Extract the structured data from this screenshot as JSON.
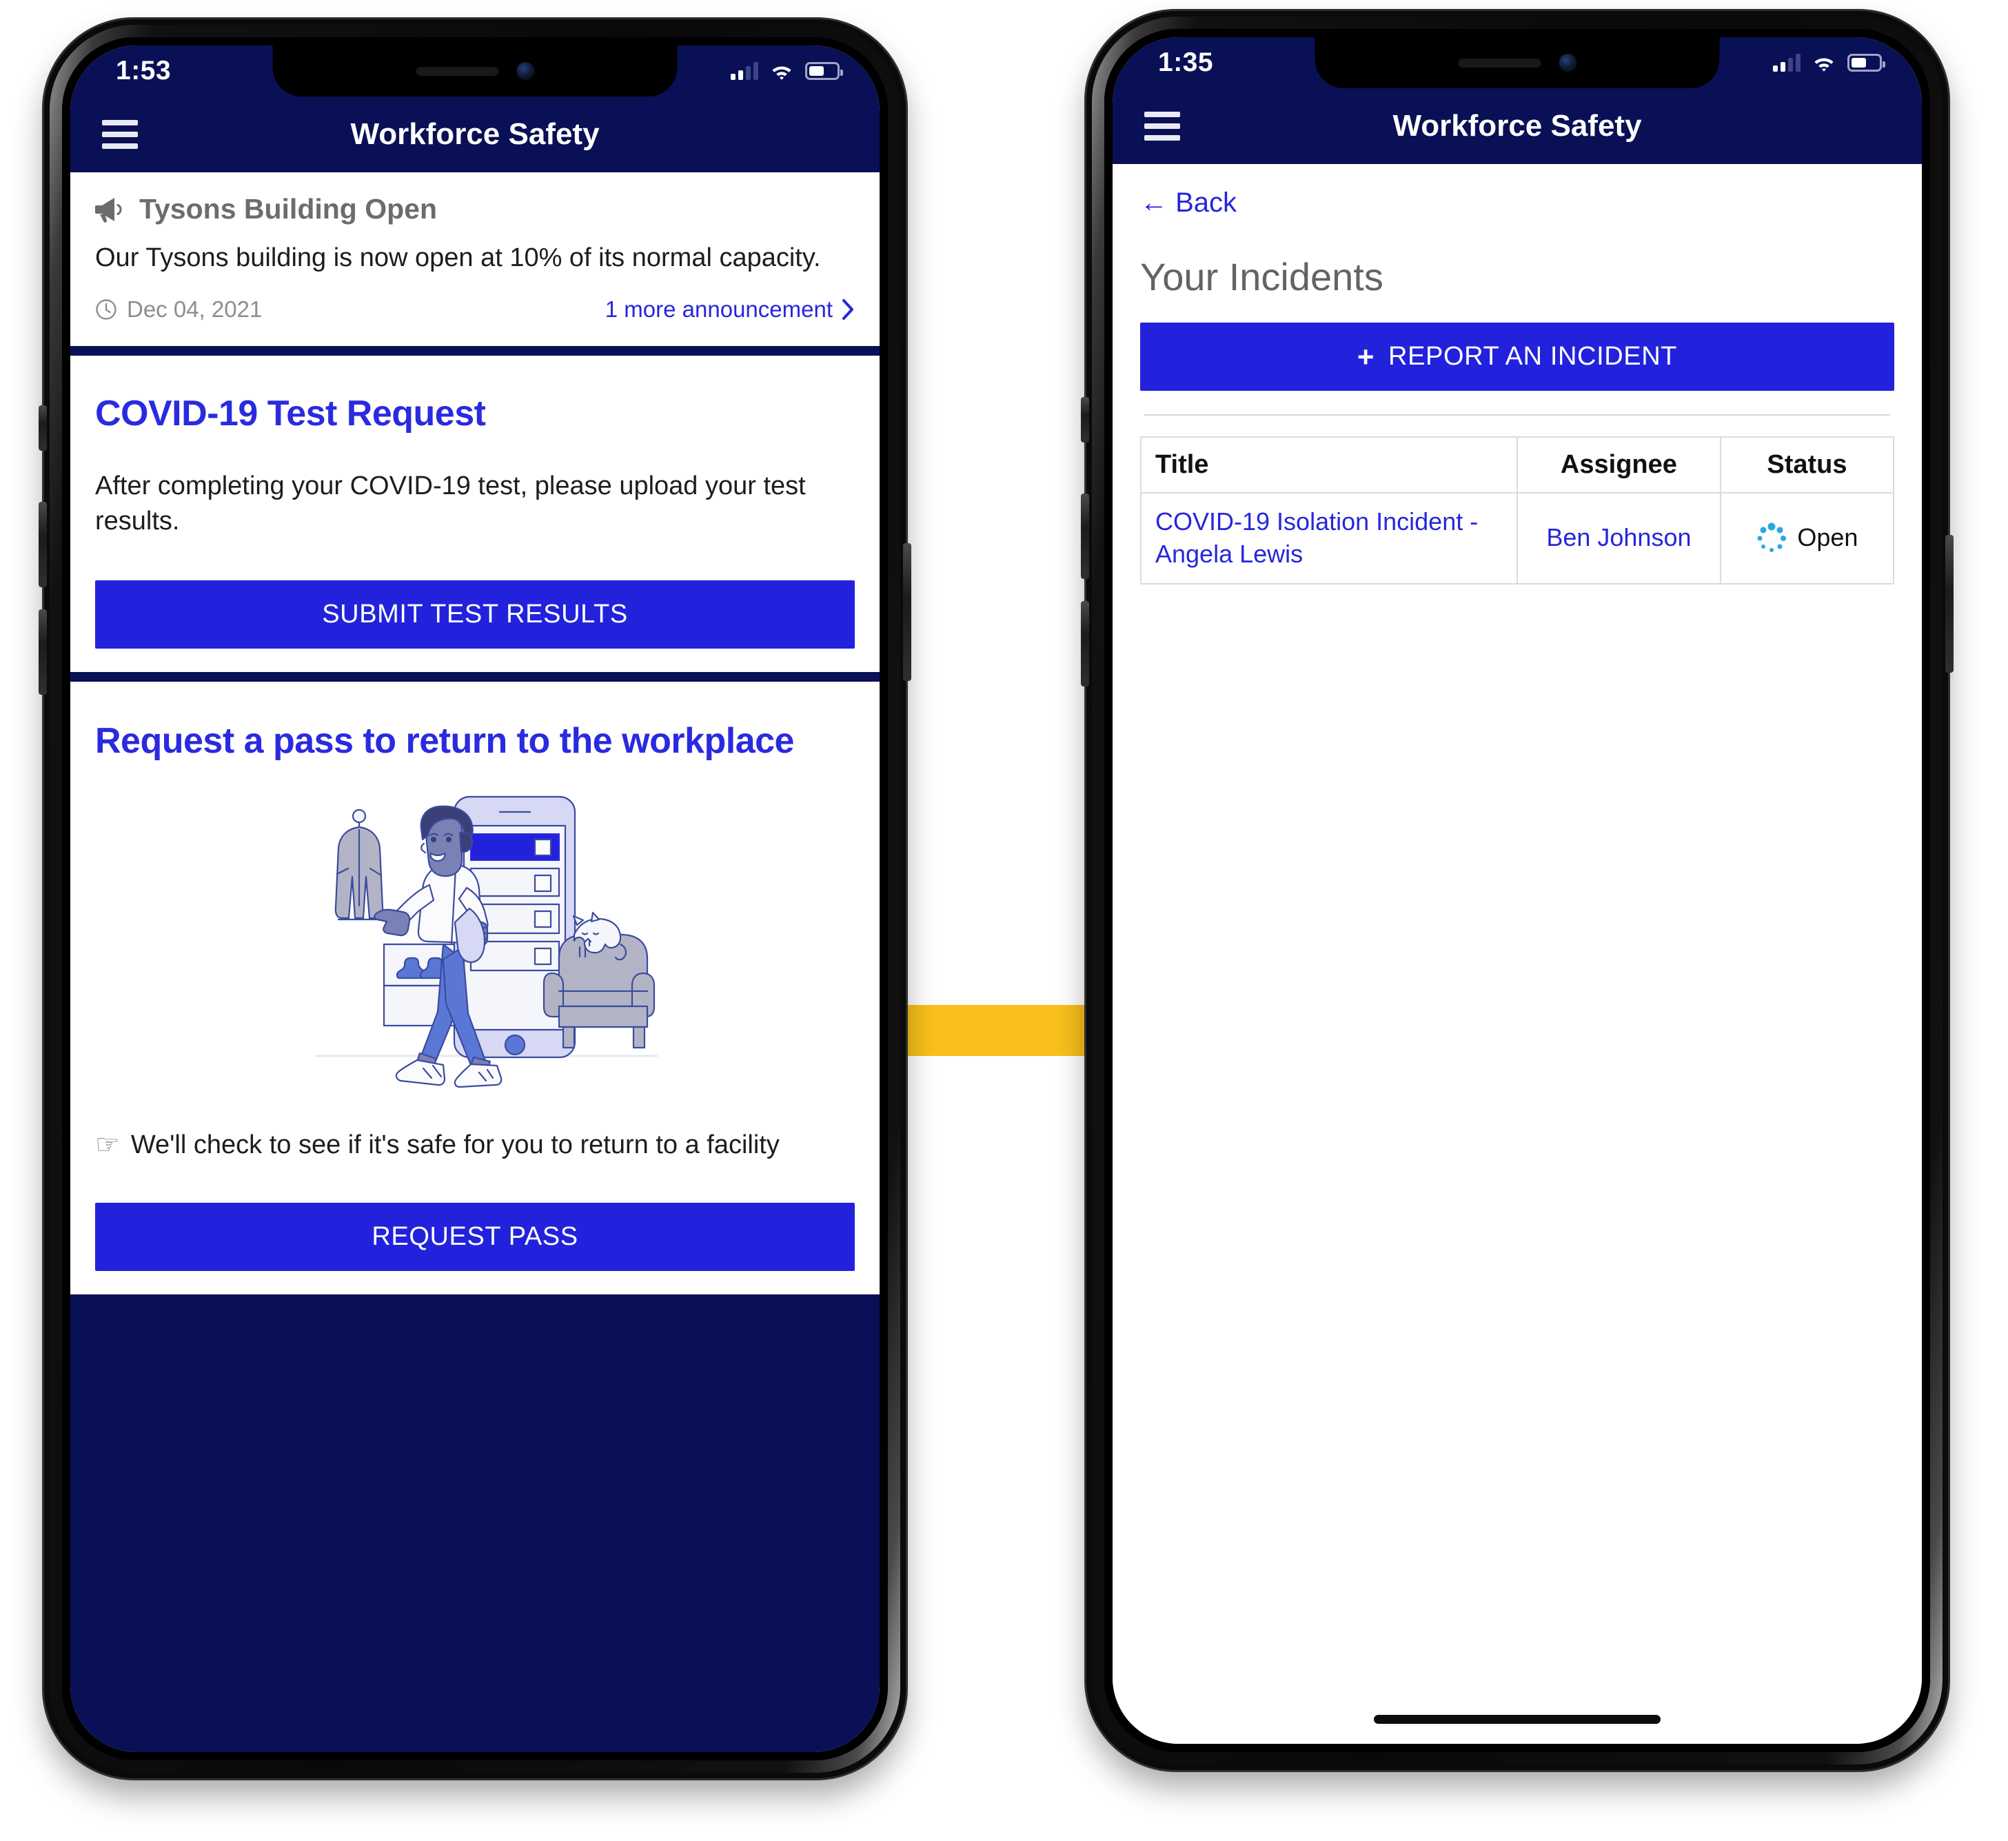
{
  "accent": {
    "navy": "#0a1055",
    "blue": "#2222dd",
    "link_blue": "#2626dd",
    "heading_blue": "#2a2ae0",
    "arrow_yellow": "#F9C01B",
    "status_cyan": "#29a8e0",
    "gray_text": "#6c6c6c"
  },
  "left_phone": {
    "status_bar": {
      "time": "1:53",
      "signal_icon": "cellular-bars-icon",
      "wifi_icon": "wifi-icon",
      "battery_icon": "battery-icon"
    },
    "navbar": {
      "menu_icon": "hamburger-menu-icon",
      "title": "Workforce Safety"
    },
    "announcement": {
      "megaphone_icon": "megaphone-icon",
      "title": "Tysons Building Open",
      "body": "Our Tysons building is now open at 10% of its normal capacity.",
      "clock_icon": "clock-icon",
      "date": "Dec 04, 2021",
      "more_link": "1 more announcement",
      "chevron_icon": "chevron-right-icon"
    },
    "test_request": {
      "heading": "COVID-19 Test Request",
      "body": "After completing your COVID-19 test, please upload your test results.",
      "button": "SUBMIT TEST RESULTS"
    },
    "pass_request": {
      "heading": "Request a pass to return to the workplace",
      "illustration_name": "person-checking-in-illustration",
      "pointer_icon": "pointing-hand-icon",
      "hint": "We'll check to see if it's safe for you to return to a facility",
      "button": "REQUEST PASS"
    }
  },
  "transition_arrow": {
    "icon": "right-arrow-icon",
    "color": "#F9C01B"
  },
  "right_phone": {
    "status_bar": {
      "time": "1:35",
      "signal_icon": "cellular-bars-icon",
      "wifi_icon": "wifi-icon",
      "battery_icon": "battery-icon"
    },
    "navbar": {
      "menu_icon": "hamburger-menu-icon",
      "title": "Workforce Safety"
    },
    "page": {
      "back_link": "← Back",
      "title": "Your Incidents",
      "report_button": "REPORT AN INCIDENT",
      "report_button_icon": "plus-icon"
    },
    "table": {
      "headers": [
        "Title",
        "Assignee",
        "Status"
      ],
      "rows": [
        {
          "title": "COVID-19 Isolation Incident - Angela Lewis",
          "assignee": "Ben Johnson",
          "status": "Open",
          "status_icon": "loading-spinner-icon"
        }
      ]
    },
    "home_indicator": "home-indicator-bar"
  }
}
